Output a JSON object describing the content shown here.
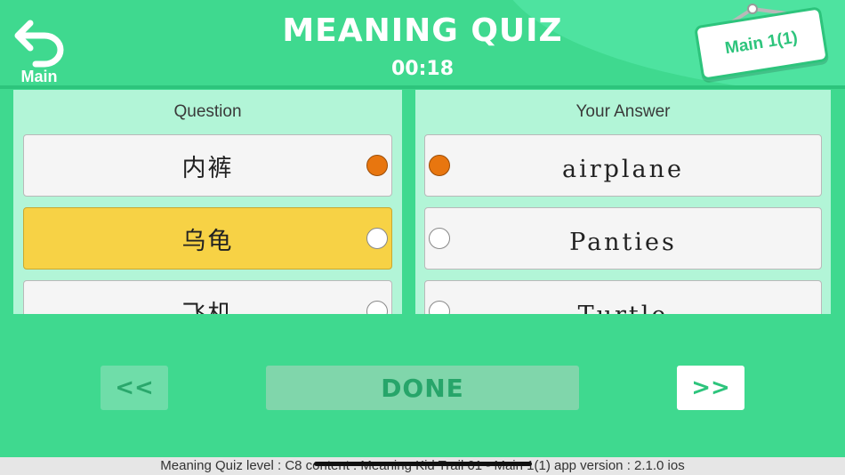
{
  "header": {
    "back_label": "Main",
    "title": "MEANING QUIZ",
    "timer": "00:18",
    "sign_label": "Main 1(1)"
  },
  "question_panel": {
    "heading": "Question",
    "items": [
      {
        "text": "内裤",
        "selected": false,
        "radio_on": true
      },
      {
        "text": "乌龟",
        "selected": true,
        "radio_on": false
      },
      {
        "text": "飞机",
        "selected": false,
        "radio_on": false
      }
    ]
  },
  "answer_panel": {
    "heading": "Your Answer",
    "items": [
      {
        "text": "airplane",
        "radio_on": true
      },
      {
        "text": "Panties",
        "radio_on": false
      },
      {
        "text": "Turtle",
        "radio_on": false
      }
    ]
  },
  "controls": {
    "prev_label": "<<",
    "done_label": "DONE",
    "next_label": ">>"
  },
  "footer": {
    "status_text": "Meaning Quiz  level : C8    content : Meaning Kid Trail 01 - Main 1(1)    app version : 2.1.0 ios"
  },
  "colors": {
    "background": "#3fd98f",
    "panel": "#b2f5d7",
    "selected_card": "#f7d245",
    "radio_on": "#e8760f",
    "accent": "#2dc47c"
  },
  "icons": {
    "back": "undo-arrow-icon"
  }
}
